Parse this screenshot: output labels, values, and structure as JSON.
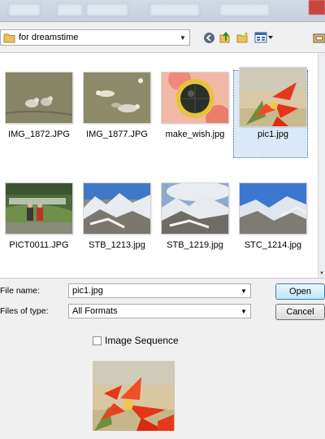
{
  "path_bar": {
    "current_folder": "for dreamstime"
  },
  "files": [
    {
      "name": "IMG_1872.JPG",
      "thumb": "water-birds",
      "selected": false
    },
    {
      "name": "IMG_1877.JPG",
      "thumb": "water-birds-2",
      "selected": false
    },
    {
      "name": "make_wish.jpg",
      "thumb": "wish-dial",
      "selected": false
    },
    {
      "name": "pic1.jpg",
      "thumb": "red-flower",
      "selected": true
    },
    {
      "name": "PICT0011.JPG",
      "thumb": "people-park",
      "selected": false
    },
    {
      "name": "STB_1213.jpg",
      "thumb": "mountains",
      "selected": false
    },
    {
      "name": "STB_1219.jpg",
      "thumb": "mountains-cloud",
      "selected": false
    },
    {
      "name": "STC_1214.jpg",
      "thumb": "mountains-2",
      "selected": false
    }
  ],
  "form": {
    "file_name_label": "File name:",
    "file_name_value": "pic1.jpg",
    "file_type_label": "Files of type:",
    "file_type_value": "All Formats",
    "open_label": "Open",
    "cancel_label": "Cancel",
    "image_sequence_label": "Image Sequence",
    "image_sequence_checked": false
  },
  "colors": {
    "selection_fill": "#dbe8f7",
    "selection_border": "#3b6fb6",
    "open_button": "#bee6fd",
    "folder": "#e8c35a"
  }
}
